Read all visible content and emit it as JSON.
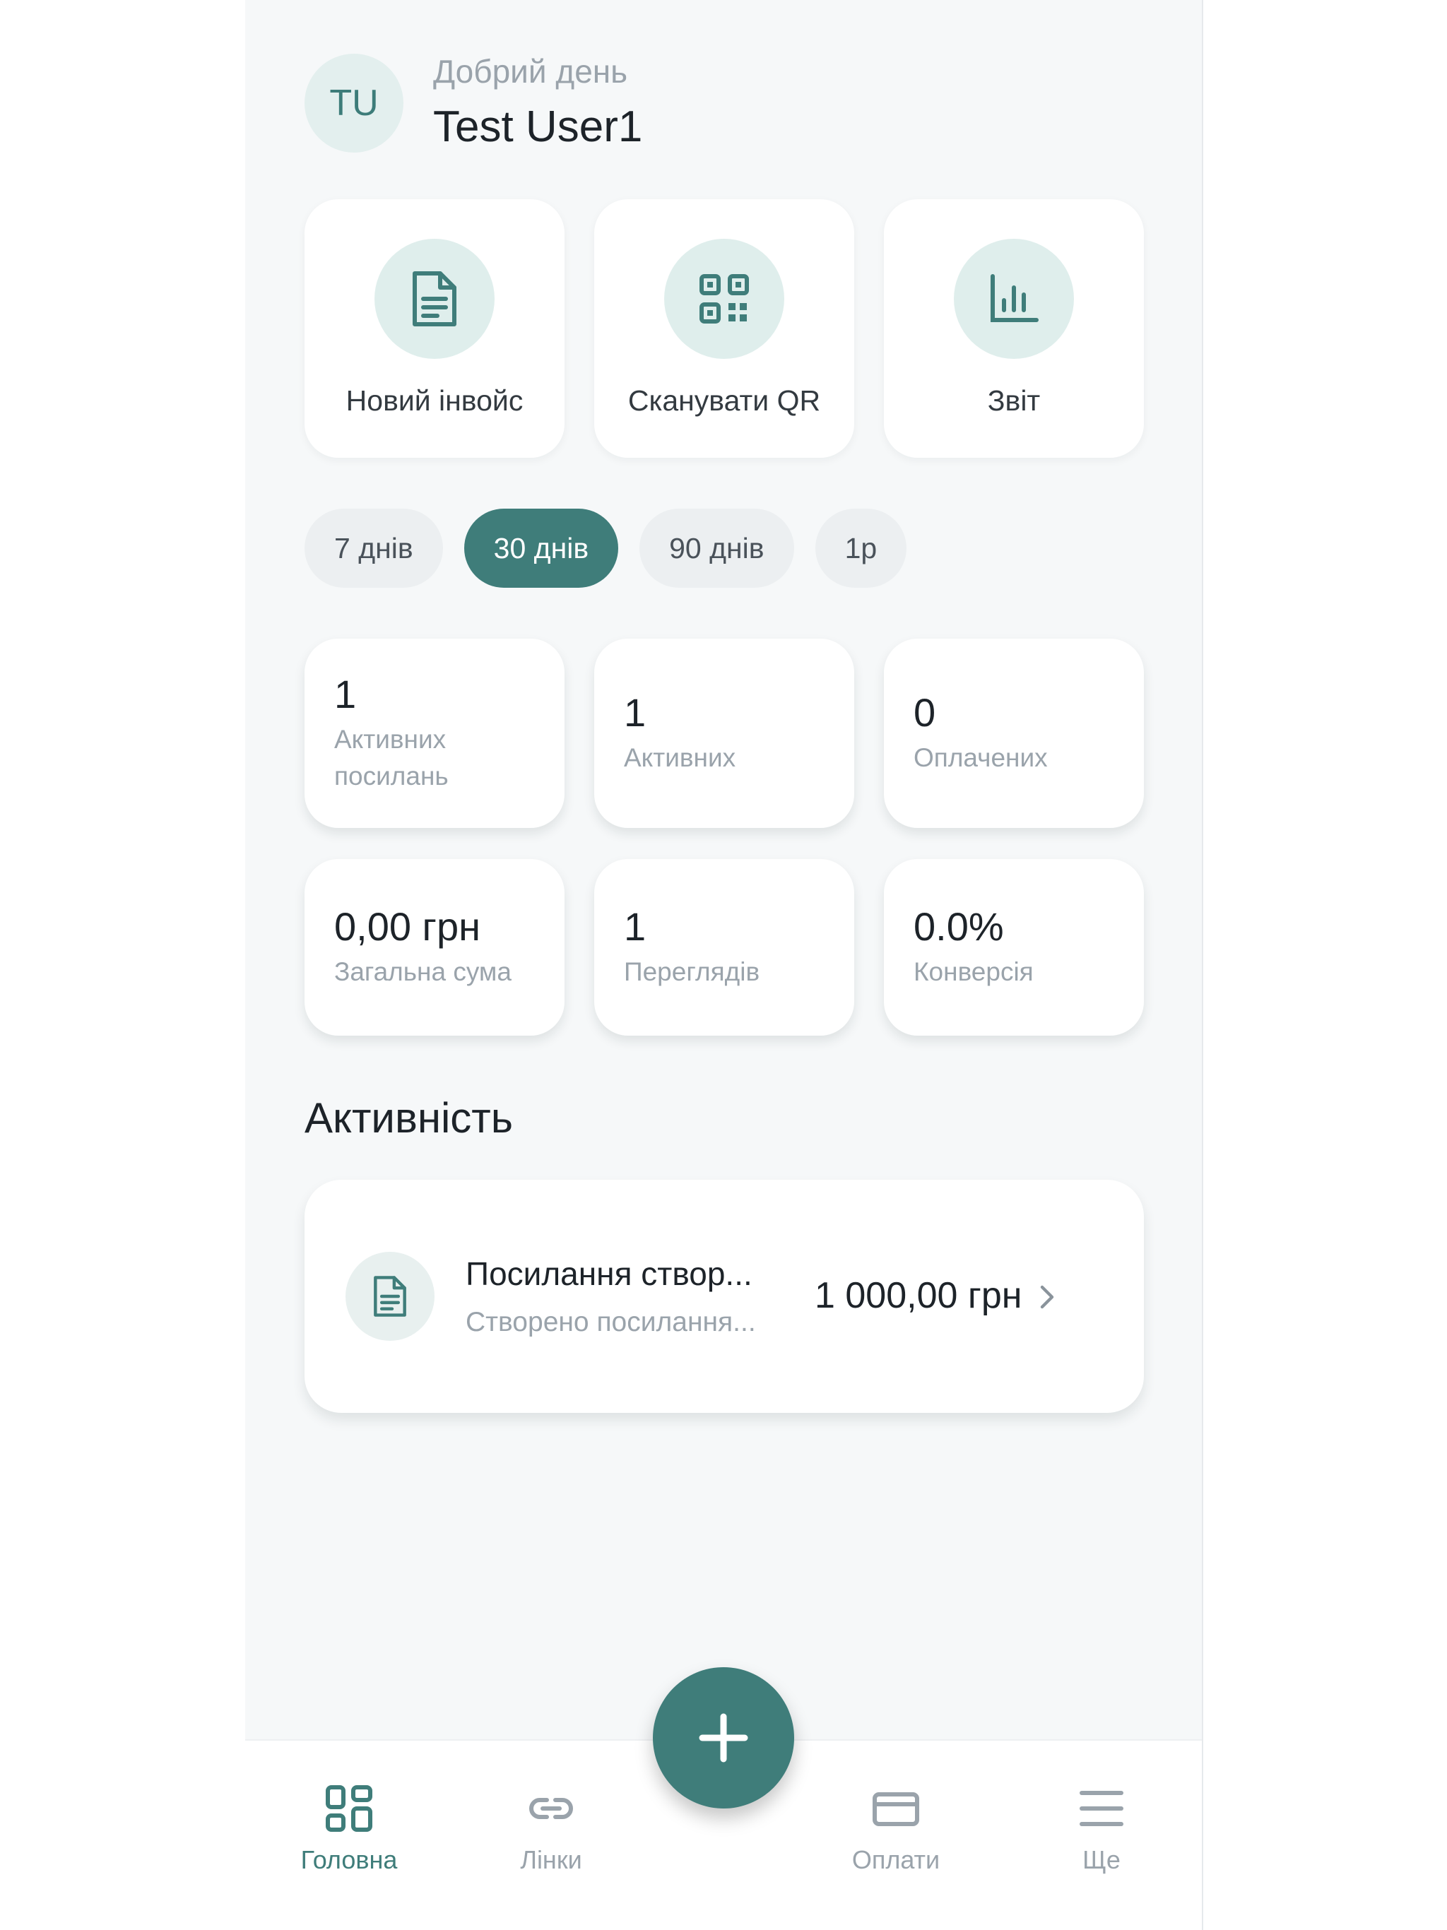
{
  "header": {
    "avatar_initials": "TU",
    "greeting": "Добрий день",
    "user_name": "Test User1"
  },
  "quick_actions": [
    {
      "label": "Новий інвойс",
      "icon": "document-icon"
    },
    {
      "label": "Сканувати QR",
      "icon": "qr-code-icon"
    },
    {
      "label": "Звіт",
      "icon": "bar-chart-icon"
    }
  ],
  "periods": [
    {
      "label": "7 днів",
      "active": false
    },
    {
      "label": "30 днів",
      "active": true
    },
    {
      "label": "90 днів",
      "active": false
    },
    {
      "label": "1р",
      "active": false
    }
  ],
  "stats": [
    {
      "value": "1",
      "label": "Активних посилань"
    },
    {
      "value": "1",
      "label": "Активних"
    },
    {
      "value": "0",
      "label": "Оплачених"
    },
    {
      "value": "0,00 грн",
      "label": "Загальна сума"
    },
    {
      "value": "1",
      "label": "Переглядів"
    },
    {
      "value": "0.0%",
      "label": "Конверсія"
    }
  ],
  "activity": {
    "title": "Активність",
    "items": [
      {
        "title": "Посилання створ...",
        "subtitle": "Створено посилання...",
        "amount": "1 000,00 грн",
        "icon": "document-icon"
      }
    ]
  },
  "bottom_nav": [
    {
      "label": "Головна",
      "icon": "grid-icon",
      "active": true
    },
    {
      "label": "Лінки",
      "icon": "link-icon",
      "active": false
    },
    {
      "label": "Оплати",
      "icon": "card-icon",
      "active": false
    },
    {
      "label": "Ще",
      "icon": "menu-icon",
      "active": false
    }
  ],
  "fab_icon": "plus-icon",
  "colors": {
    "accent": "#3f7d7a",
    "accent_light": "#dfeeec",
    "background": "#f6f8f9",
    "text_primary": "#1d2329",
    "text_secondary": "#9aa3ab"
  }
}
